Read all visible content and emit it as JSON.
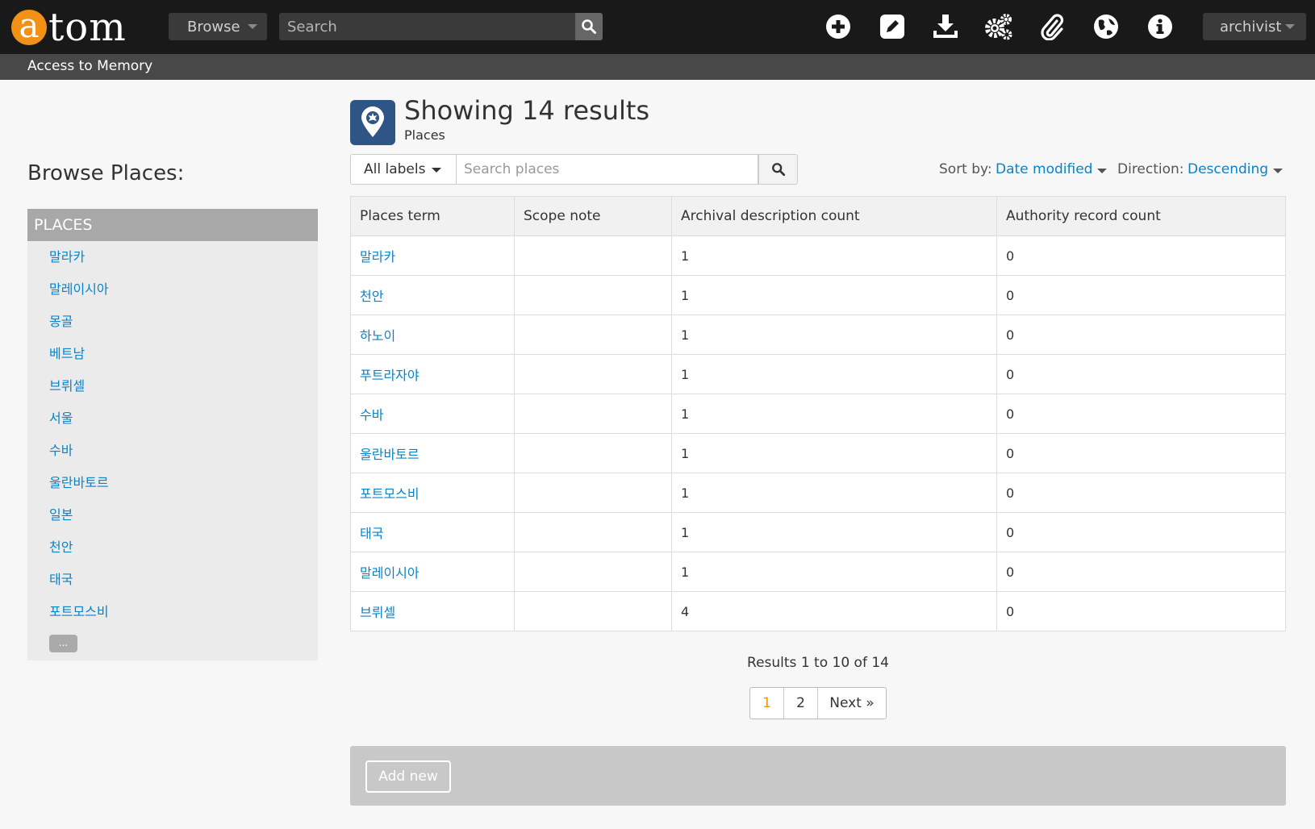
{
  "header": {
    "logo_letter": "a",
    "logo_rest": "tom",
    "browse_label": "Browse",
    "search_placeholder": "Search",
    "user_label": "archivist",
    "site_name": "Access to Memory",
    "icons": [
      "plus-circle-icon",
      "pencil-icon",
      "download-icon",
      "gears-icon",
      "paperclip-icon",
      "globe-icon",
      "info-icon"
    ]
  },
  "sidebar": {
    "heading": "Browse Places:",
    "facet_title": "PLACES",
    "items": [
      "말라카",
      "말레이시아",
      "몽골",
      "베트남",
      "브뤼셀",
      "서울",
      "수바",
      "울란바토르",
      "일본",
      "천안",
      "태국",
      "포트모스비"
    ],
    "more_label": "..."
  },
  "main": {
    "title": "Showing 14 results",
    "subtitle": "Places",
    "labels_filter": "All labels",
    "search_placeholder": "Search places",
    "sort_label": "Sort by:",
    "sort_value": "Date modified",
    "direction_label": "Direction:",
    "direction_value": "Descending"
  },
  "table": {
    "headers": [
      "Places term",
      "Scope note",
      "Archival description count",
      "Authority record count"
    ],
    "rows": [
      {
        "term": "말라카",
        "scope": "",
        "desc": "1",
        "auth": "0"
      },
      {
        "term": "천안",
        "scope": "",
        "desc": "1",
        "auth": "0"
      },
      {
        "term": "하노이",
        "scope": "",
        "desc": "1",
        "auth": "0"
      },
      {
        "term": "푸트라자야",
        "scope": "",
        "desc": "1",
        "auth": "0"
      },
      {
        "term": "수바",
        "scope": "",
        "desc": "1",
        "auth": "0"
      },
      {
        "term": "울란바토르",
        "scope": "",
        "desc": "1",
        "auth": "0"
      },
      {
        "term": "포트모스비",
        "scope": "",
        "desc": "1",
        "auth": "0"
      },
      {
        "term": "태국",
        "scope": "",
        "desc": "1",
        "auth": "0"
      },
      {
        "term": "말레이시아",
        "scope": "",
        "desc": "1",
        "auth": "0"
      },
      {
        "term": "브뤼셀",
        "scope": "",
        "desc": "4",
        "auth": "0"
      }
    ]
  },
  "pagination": {
    "summary": "Results 1 to 10 of 14",
    "pages": [
      "1",
      "2"
    ],
    "next_label": "Next »"
  },
  "actions": {
    "add_new_label": "Add new"
  },
  "colors": {
    "brand_orange": "#f39117",
    "link_blue": "#0a83c6",
    "header_dark": "#191919",
    "subbar_gray": "#484848"
  }
}
